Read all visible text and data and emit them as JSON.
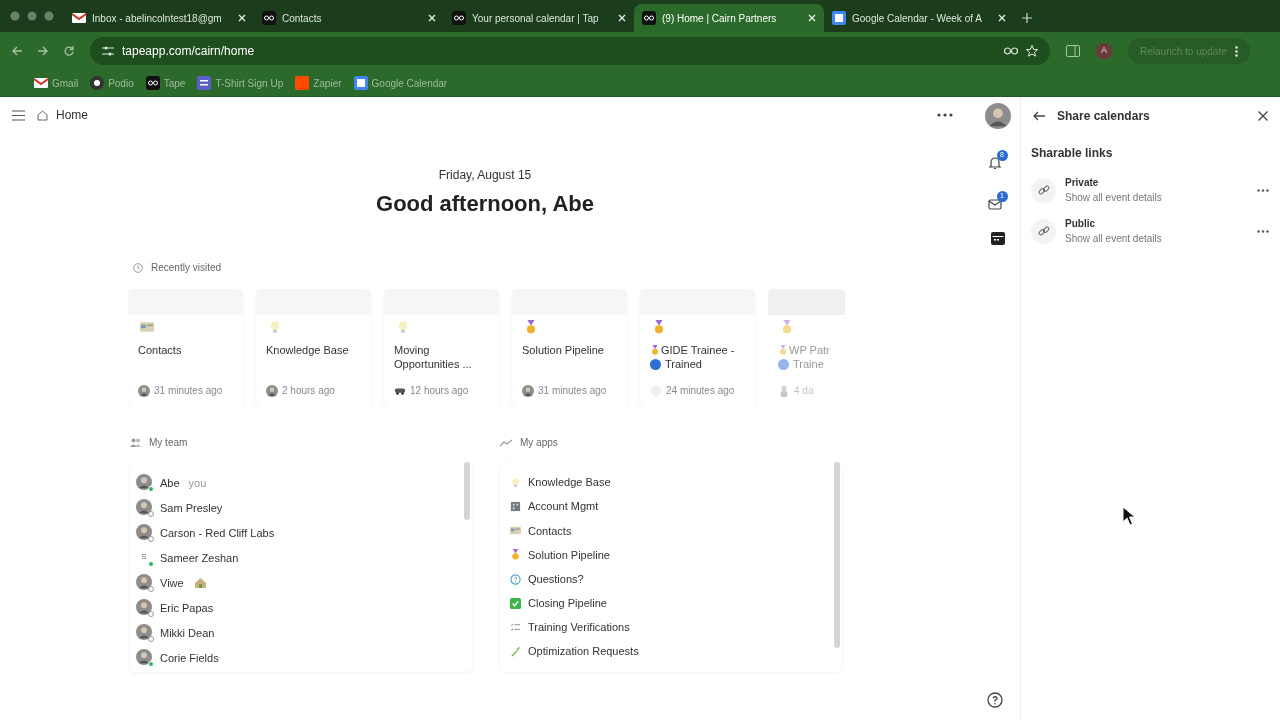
{
  "browser": {
    "tabs": [
      {
        "title": "Inbox - abelincolntest18@gm",
        "kind": "gmail",
        "selected": false
      },
      {
        "title": "Contacts",
        "kind": "tape",
        "selected": false
      },
      {
        "title": "Your personal calendar | Tap",
        "kind": "tape",
        "selected": false
      },
      {
        "title": "(9) Home | Cairn Partners",
        "kind": "tape",
        "selected": true
      },
      {
        "title": "Google Calendar - Week of A",
        "kind": "gcal",
        "selected": false
      }
    ],
    "address": "tapeapp.com/cairn/home",
    "profile": "A",
    "update_button": "Relaunch to update",
    "bookmarks": [
      {
        "label": "Gmail",
        "kind": "gmail"
      },
      {
        "label": "Podio",
        "kind": "podio"
      },
      {
        "label": "Tape",
        "kind": "tape"
      },
      {
        "label": "T-Shirt Sign Up",
        "kind": "form"
      },
      {
        "label": "Zapier",
        "kind": "zapier"
      },
      {
        "label": "Google Calendar",
        "kind": "gcal"
      }
    ]
  },
  "header": {
    "title": "Home"
  },
  "date": "Friday, August 15",
  "greeting": "Good afternoon, Abe",
  "recent": {
    "label": "Recently visited",
    "cards": [
      {
        "kind": "card",
        "title": "Contacts",
        "time": "31 minutes ago",
        "faded": false
      },
      {
        "kind": "bulb",
        "title": "Knowledge Base",
        "time": "2 hours ago",
        "faded": false
      },
      {
        "kind": "bulb",
        "title": "Moving Opportunities ...",
        "time": "12 hours ago",
        "faded": false
      },
      {
        "kind": "medal",
        "title": "Solution Pipeline",
        "time": "31 minutes ago",
        "faded": false
      },
      {
        "kind": "medal",
        "title": "GIDE Trainee -",
        "title_end": "Trained",
        "time": "24 minutes ago",
        "faded": false
      },
      {
        "kind": "medal",
        "title": "WP Patr",
        "title_end": "Traine",
        "time": "4 da",
        "faded": true
      }
    ]
  },
  "team": {
    "label": "My team",
    "members": [
      {
        "name": "Abe",
        "note": "you",
        "kind": "photo",
        "online": true
      },
      {
        "name": "Sam Presley",
        "kind": "photo",
        "online": false
      },
      {
        "name": "Carson - Red Cliff Labs",
        "kind": "photo",
        "online": false
      },
      {
        "name": "Sameer Zeshan",
        "initial": "S",
        "kind": "initial",
        "online": true
      },
      {
        "name": "Viwe",
        "kind": "photo_house",
        "online": false
      },
      {
        "name": "Eric Papas",
        "kind": "photo",
        "online": false
      },
      {
        "name": "Mikki Dean",
        "kind": "photo",
        "online": false
      },
      {
        "name": "Corie Fields",
        "kind": "photo",
        "online": true
      }
    ]
  },
  "apps": {
    "label": "My apps",
    "items": [
      {
        "name": "Knowledge Base",
        "kind": "bulb"
      },
      {
        "name": "Account Mgmt",
        "kind": "building"
      },
      {
        "name": "Contacts",
        "kind": "card"
      },
      {
        "name": "Solution Pipeline",
        "kind": "medal"
      },
      {
        "name": "Questions?",
        "kind": "question"
      },
      {
        "name": "Closing Pipeline",
        "kind": "check"
      },
      {
        "name": "Training Verifications",
        "kind": "list"
      },
      {
        "name": "Optimization Requests",
        "kind": "sprout"
      }
    ]
  },
  "rail": {
    "notifications": "8",
    "messages": "1"
  },
  "panel": {
    "title": "Share calendars",
    "section": "Sharable links",
    "links": [
      {
        "title": "Private",
        "subtitle": "Show all event details"
      },
      {
        "title": "Public",
        "subtitle": "Show all event details"
      }
    ]
  }
}
